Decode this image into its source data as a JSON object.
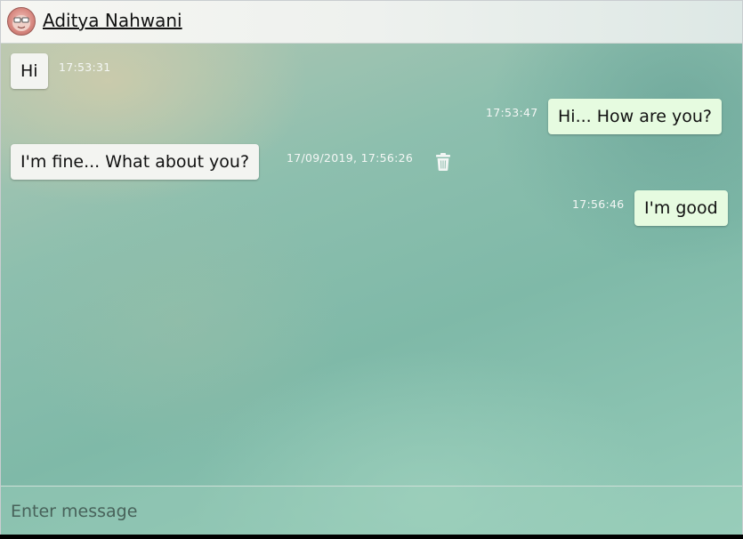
{
  "header": {
    "contact_name": "Aditya Nahwani",
    "avatar_icon": "user-avatar-icon"
  },
  "messages": [
    {
      "direction": "incoming",
      "text": "Hi",
      "timestamp": "17:53:31"
    },
    {
      "direction": "outgoing",
      "text": "Hi... How are you?",
      "timestamp": "17:53:47"
    },
    {
      "direction": "incoming",
      "text": "I'm fine... What about you?",
      "timestamp": "17/09/2019, 17:56:26",
      "action_icon": "trash-icon"
    },
    {
      "direction": "outgoing",
      "text": "I'm good",
      "timestamp": "17:56:46"
    }
  ],
  "composer": {
    "placeholder": "Enter message",
    "value": ""
  },
  "colors": {
    "incoming_bubble": "#f3f4f1",
    "outgoing_bubble": "#e6fbe0",
    "timestamp_text": "#f4f7f5"
  }
}
